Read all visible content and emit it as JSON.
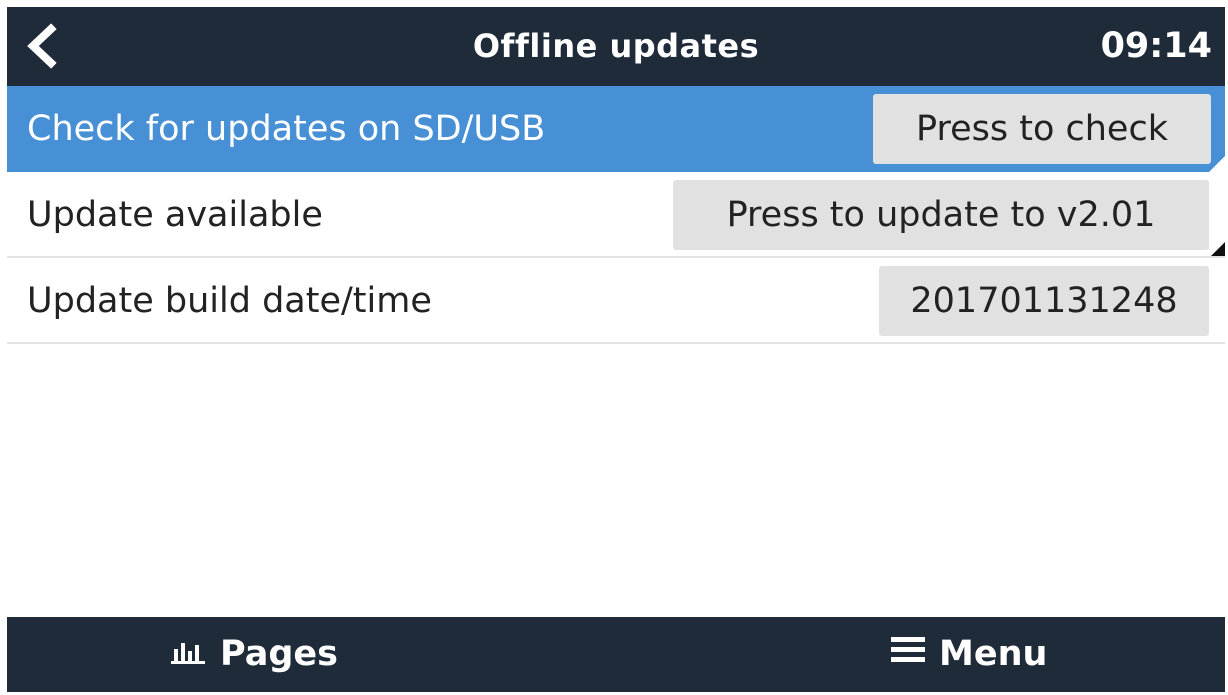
{
  "header": {
    "back_icon": "chevron-left-icon",
    "title": "Offline updates",
    "clock": "09:14"
  },
  "rows": [
    {
      "label": "Check for updates on SD/USB",
      "value": "Press to check",
      "selected": true
    },
    {
      "label": "Update available",
      "value": "Press to update to v2.01",
      "selected": false
    },
    {
      "label": "Update build date/time",
      "value": "201701131248",
      "selected": false
    }
  ],
  "footer": {
    "pages_label": "Pages",
    "pages_icon": "bar-chart-icon",
    "menu_label": "Menu",
    "menu_icon": "hamburger-menu-icon"
  },
  "colors": {
    "bar_bg": "#1f2b39",
    "selected_row": "#4790d6",
    "value_box": "#e1e1e1"
  }
}
